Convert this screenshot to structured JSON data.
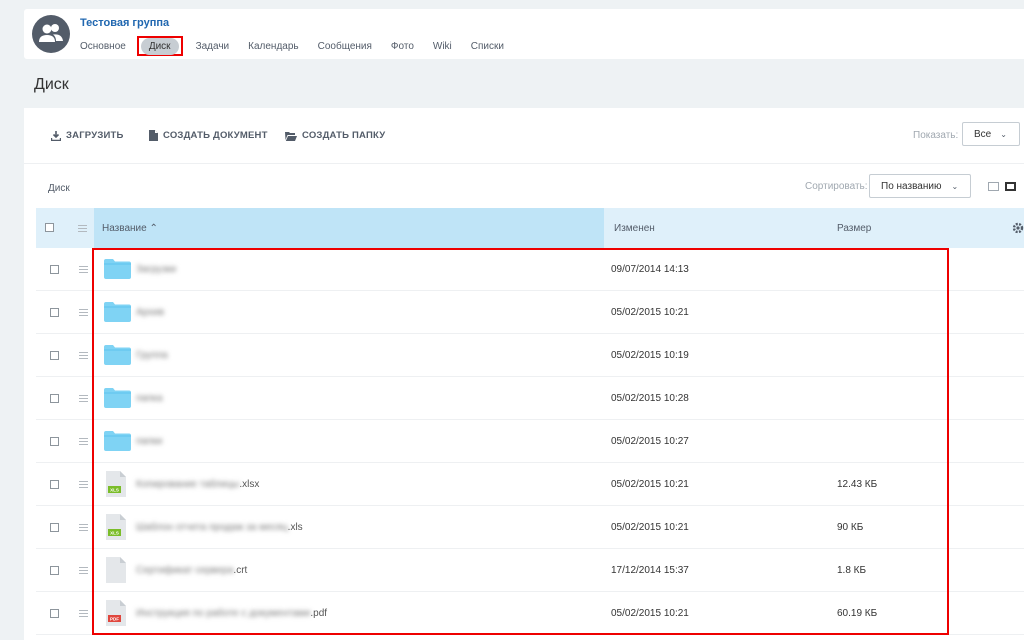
{
  "group": {
    "title": "Тестовая группа",
    "nav": [
      {
        "label": "Основное",
        "active": false
      },
      {
        "label": "Диск",
        "active": true
      },
      {
        "label": "Задачи",
        "active": false
      },
      {
        "label": "Календарь",
        "active": false
      },
      {
        "label": "Сообщения",
        "active": false
      },
      {
        "label": "Фото",
        "active": false
      },
      {
        "label": "Wiki",
        "active": false
      },
      {
        "label": "Списки",
        "active": false
      }
    ]
  },
  "page": {
    "title": "Диск"
  },
  "toolbar": {
    "upload_label": "ЗАГРУЗИТЬ",
    "create_doc_label": "СОЗДАТЬ ДОКУМЕНТ",
    "create_folder_label": "СОЗДАТЬ ПАПКУ",
    "show_label": "Показать:",
    "show_value": "Все"
  },
  "breadcrumb": "Диск",
  "sort": {
    "label": "Сортировать:",
    "value": "По названию"
  },
  "grid": {
    "columns": {
      "name": "Название ⌃",
      "modified": "Изменен",
      "size": "Размер"
    },
    "rows": [
      {
        "type": "folder",
        "name": "Загрузки",
        "ext": "",
        "modified": "09/07/2014 14:13",
        "size": ""
      },
      {
        "type": "folder",
        "name": "Архив",
        "ext": "",
        "modified": "05/02/2015 10:21",
        "size": ""
      },
      {
        "type": "folder",
        "name": "Группа",
        "ext": "",
        "modified": "05/02/2015 10:19",
        "size": ""
      },
      {
        "type": "folder",
        "name": "папка",
        "ext": "",
        "modified": "05/02/2015 10:28",
        "size": ""
      },
      {
        "type": "folder",
        "name": "папки",
        "ext": "",
        "modified": "05/02/2015 10:27",
        "size": ""
      },
      {
        "type": "xls",
        "name": "Копирование таблицы",
        "ext": ".xlsx",
        "modified": "05/02/2015 10:21",
        "size": "12.43 КБ"
      },
      {
        "type": "xls",
        "name": "Шаблон отчета продаж за месяц",
        "ext": ".xls",
        "modified": "05/02/2015 10:21",
        "size": "90 КБ"
      },
      {
        "type": "file",
        "name": "Сертификат сервера",
        "ext": ".crt",
        "modified": "17/12/2014 15:37",
        "size": "1.8 КБ"
      },
      {
        "type": "pdf",
        "name": "Инструкция по работе с документами",
        "ext": ".pdf",
        "modified": "05/02/2015 10:21",
        "size": "60.19 КБ"
      }
    ]
  },
  "badges": {
    "xls": "XLS",
    "pdf": "PDF"
  },
  "colors": {
    "accent": "#2067b0",
    "folder": "#7fd3f4",
    "xls": "#7bbd29",
    "pdf": "#e0473e",
    "highlight": "#ee0000"
  }
}
